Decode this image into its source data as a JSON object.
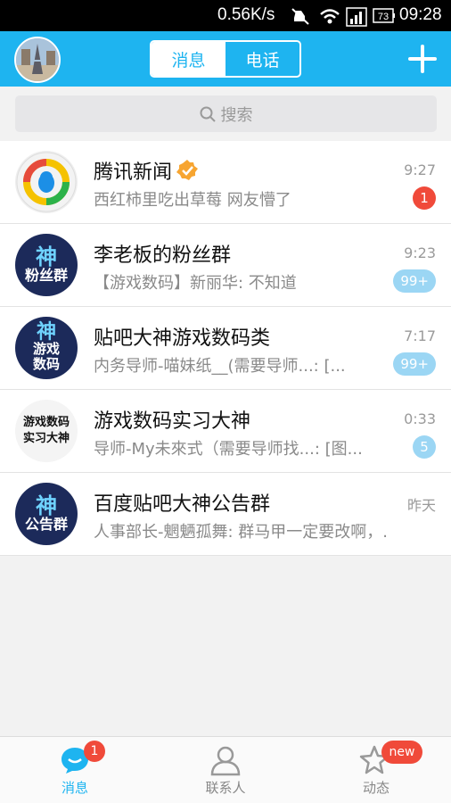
{
  "status_bar": {
    "net_speed": "0.56K/s",
    "time": "09:28",
    "battery": "73"
  },
  "header": {
    "segments": [
      {
        "label": "消息",
        "active": true
      },
      {
        "label": "电话",
        "active": false
      }
    ]
  },
  "search": {
    "placeholder": "搜索"
  },
  "conversations": [
    {
      "name": "腾讯新闻",
      "message": "西红柿里吃出草莓 网友懵了",
      "time": "9:27",
      "badge": "1",
      "badge_color": "red",
      "avatar_text": ""
    },
    {
      "name": "李老板的粉丝群",
      "message": "【游戏数码】新丽华: 不知道",
      "time": "9:23",
      "badge": "99+",
      "badge_color": "blue",
      "avatar_text": "粉丝群"
    },
    {
      "name": "贴吧大神游戏数码类",
      "message": "内务导师-喵妹纸__(需要导师...: [...",
      "time": "7:17",
      "badge": "99+",
      "badge_color": "blue",
      "avatar_text": "游戏数码"
    },
    {
      "name": "游戏数码实习大神",
      "message": "导师-My未來式（需要导师找...: [图...",
      "time": "0:33",
      "badge": "5",
      "badge_color": "blue",
      "avatar_text": "游戏数码实习大神"
    },
    {
      "name": "百度贴吧大神公告群",
      "message": "人事部长-魍魉孤舞: 群马甲一定要改啊，...",
      "time": "昨天",
      "badge": "",
      "badge_color": "",
      "avatar_text": "公告群"
    }
  ],
  "bottom_nav": {
    "tabs": [
      {
        "label": "消息",
        "active": true,
        "badge": "1"
      },
      {
        "label": "联系人",
        "active": false,
        "badge": ""
      },
      {
        "label": "动态",
        "active": false,
        "badge": "new"
      }
    ]
  },
  "colors": {
    "accent": "#1eb4f0",
    "badge_red": "#f04a3a",
    "badge_blue": "#9bd6f4"
  }
}
